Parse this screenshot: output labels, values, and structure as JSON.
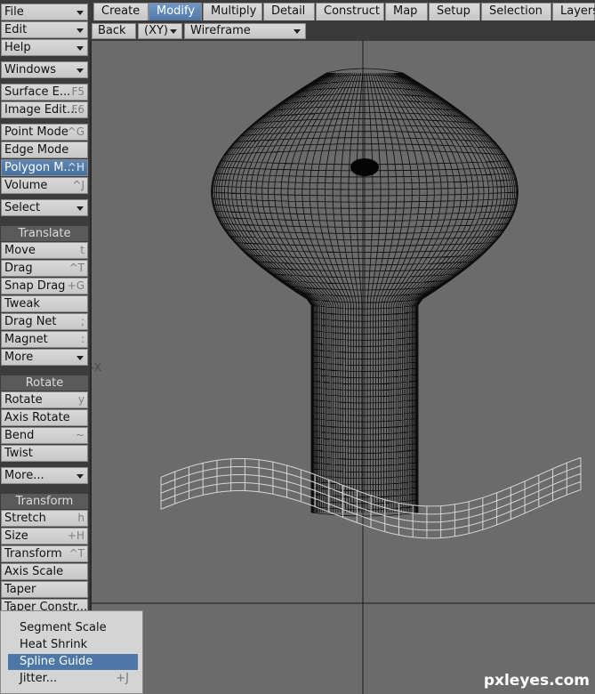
{
  "tabs": [
    {
      "label": "Create"
    },
    {
      "label": "Modify"
    },
    {
      "label": "Multiply"
    },
    {
      "label": "Detail"
    },
    {
      "label": "Construct"
    },
    {
      "label": "Map"
    },
    {
      "label": "Setup"
    },
    {
      "label": "Selection"
    },
    {
      "label": "Layers"
    }
  ],
  "active_tab": "Modify",
  "viewport": {
    "view_label": "Back",
    "axis_label": "(XY)",
    "render_mode": "Wireframe",
    "axis_marker": "-X"
  },
  "sidebar": {
    "file": "File",
    "edit": "Edit",
    "help": "Help",
    "windows": "Windows",
    "surface_editor": {
      "label": "Surface E...",
      "shortcut": "F5"
    },
    "image_editor": {
      "label": "Image Edit...",
      "shortcut": "F6"
    },
    "point_mode": {
      "label": "Point Mode",
      "shortcut": "^G"
    },
    "edge_mode": {
      "label": "Edge Mode",
      "shortcut": ""
    },
    "polygon_mode": {
      "label": "Polygon M...",
      "shortcut": "^H"
    },
    "volume": {
      "label": "Volume",
      "shortcut": "^J"
    },
    "select": "Select",
    "translate_header": "Translate",
    "move": {
      "label": "Move",
      "shortcut": "t"
    },
    "drag": {
      "label": "Drag",
      "shortcut": "^T"
    },
    "snap_drag": {
      "label": "Snap Drag",
      "shortcut": "+G"
    },
    "tweak": {
      "label": "Tweak",
      "shortcut": ""
    },
    "drag_net": {
      "label": "Drag Net",
      "shortcut": ";"
    },
    "magnet": {
      "label": "Magnet",
      "shortcut": ":"
    },
    "more1": "More",
    "rotate_header": "Rotate",
    "rotate": {
      "label": "Rotate",
      "shortcut": "y"
    },
    "axis_rotate": {
      "label": "Axis Rotate",
      "shortcut": ""
    },
    "bend": {
      "label": "Bend",
      "shortcut": "~"
    },
    "twist": {
      "label": "Twist",
      "shortcut": ""
    },
    "more2": "More...",
    "transform_header": "Transform",
    "stretch": {
      "label": "Stretch",
      "shortcut": "h"
    },
    "size": {
      "label": "Size",
      "shortcut": "+H"
    },
    "transform": {
      "label": "Transform",
      "shortcut": "^T"
    },
    "axis_scale": {
      "label": "Axis Scale",
      "shortcut": ""
    },
    "taper": {
      "label": "Taper",
      "shortcut": ""
    },
    "taper_constr": {
      "label": "Taper Constr...",
      "shortcut": ""
    }
  },
  "popup_menu": {
    "items": [
      {
        "label": "Segment Scale",
        "shortcut": ""
      },
      {
        "label": "Heat Shrink",
        "shortcut": ""
      },
      {
        "label": "Spline Guide",
        "shortcut": ""
      },
      {
        "label": "Jitter...",
        "shortcut": "+J"
      }
    ],
    "highlighted": "Spline Guide"
  },
  "watermark": "pxleyes.com",
  "colors": {
    "accent": "#4f79a8",
    "viewport_bg": "#6b6b6b",
    "panel_bg": "#3c3c3c",
    "button_bg": "#cfcfcf"
  }
}
